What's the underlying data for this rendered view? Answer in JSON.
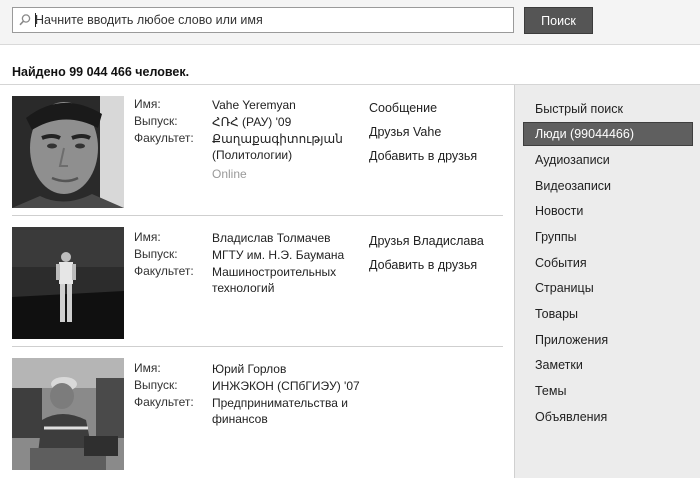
{
  "search": {
    "placeholder": "Начните вводить любое слово или имя",
    "button_label": "Поиск"
  },
  "results_summary": "Найдено 99 044 466 человек.",
  "labels": {
    "name": "Имя:",
    "graduation": "Выпуск:",
    "faculty": "Факультет:"
  },
  "results": [
    {
      "name": "Vahe Yeremyan",
      "graduation": "ՀՌՀ (РАУ) '09",
      "faculty": "Քաղաքագիտության (Политологии)",
      "status": "Online",
      "actions": [
        "Сообщение",
        "Друзья Vahe",
        "Добавить в друзья"
      ]
    },
    {
      "name": "Владислав Толмачев",
      "graduation": "МГТУ им. Н.Э. Баумана",
      "faculty": "Машиностроительных технологий",
      "actions": [
        "Друзья Владислава",
        "Добавить в друзья"
      ]
    },
    {
      "name": "Юрий Горлов",
      "graduation": "ИНЖЭКОН (СПбГИЭУ) '07",
      "faculty": "Предпринимательства и финансов",
      "actions": []
    }
  ],
  "sidebar": {
    "items": [
      {
        "label": "Быстрый поиск"
      },
      {
        "label": "Люди (99044466)",
        "active": true
      },
      {
        "label": "Аудиозаписи"
      },
      {
        "label": "Видеозаписи"
      },
      {
        "label": "Новости"
      },
      {
        "label": "Группы"
      },
      {
        "label": "События"
      },
      {
        "label": "Страницы"
      },
      {
        "label": "Товары"
      },
      {
        "label": "Приложения"
      },
      {
        "label": "Заметки"
      },
      {
        "label": "Темы"
      },
      {
        "label": "Объявления"
      }
    ]
  }
}
